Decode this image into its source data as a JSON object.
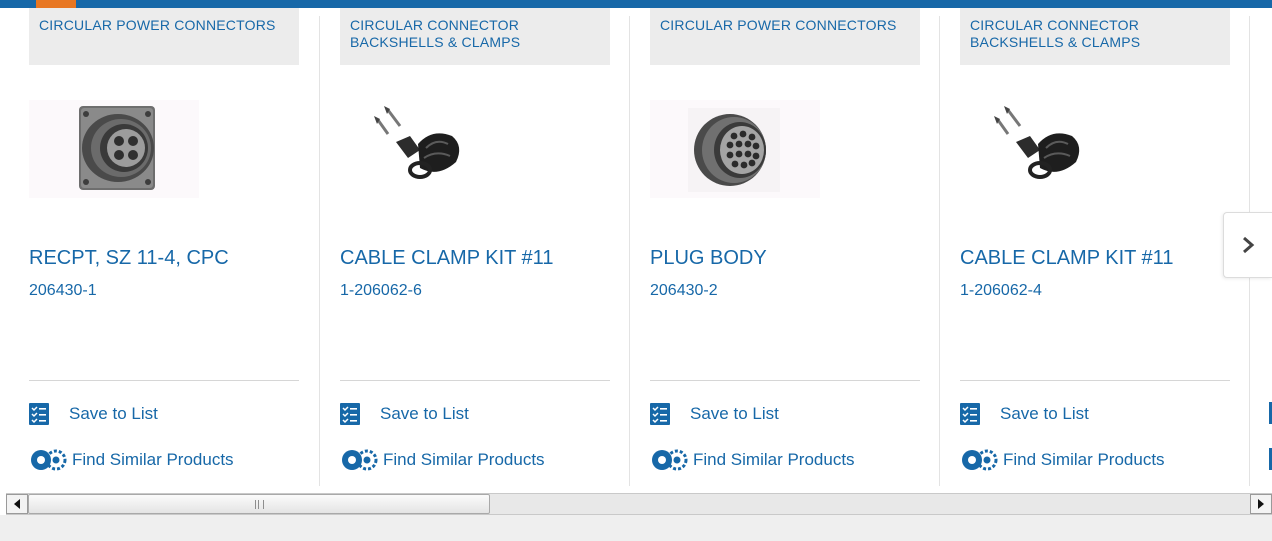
{
  "carousel": {
    "cards": [
      {
        "category": "CIRCULAR POWER CONNECTORS",
        "name": "RECPT, SZ 11-4, CPC",
        "part_number": "206430-1",
        "image": "4-pin-circular-receptacle",
        "save_label": "Save to List",
        "similar_label": "Find Similar Products"
      },
      {
        "category": "CIRCULAR CONNECTOR BACKSHELLS & CLAMPS",
        "name": "CABLE CLAMP KIT #11",
        "part_number": "1-206062-6",
        "image": "cable-clamp-kit",
        "save_label": "Save to List",
        "similar_label": "Find Similar Products"
      },
      {
        "category": "CIRCULAR POWER CONNECTORS",
        "name": "PLUG BODY",
        "part_number": "206430-2",
        "image": "multi-pin-plug-body",
        "save_label": "Save to List",
        "similar_label": "Find Similar Products"
      },
      {
        "category": "CIRCULAR CONNECTOR BACKSHELLS & CLAMPS",
        "name": "CABLE CLAMP KIT #11",
        "part_number": "1-206062-4",
        "image": "cable-clamp-kit",
        "save_label": "Save to List",
        "similar_label": "Find Similar Products"
      }
    ],
    "next_icon": "chevron-right-icon"
  },
  "scrollbar": {
    "left_icon": "scroll-left-arrow",
    "right_icon": "scroll-right-arrow",
    "position": 0
  },
  "colors": {
    "link": "#1768a8",
    "accent_orange": "#e87722",
    "category_bg": "#ececec"
  }
}
